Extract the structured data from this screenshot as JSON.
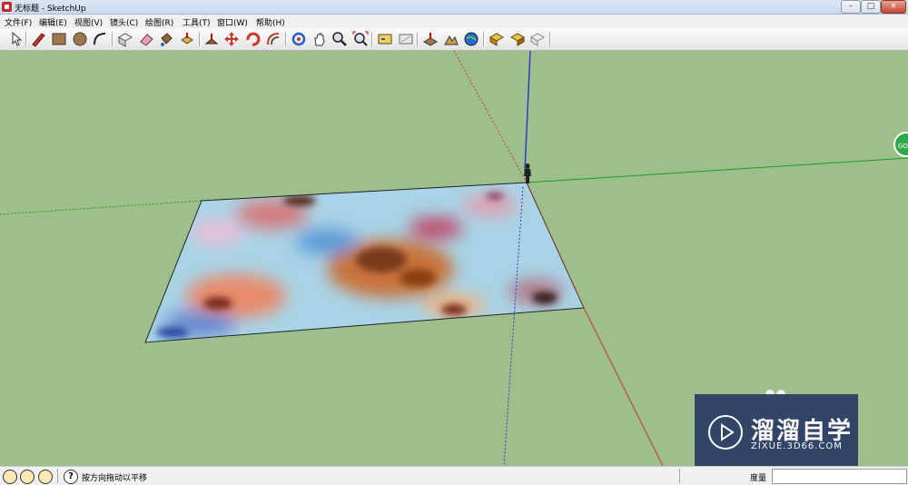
{
  "window": {
    "title": "无标题 - SketchUp"
  },
  "menu": [
    "文件(F)",
    "编辑(E)",
    "视图(V)",
    "镜头(C)",
    "绘图(R)",
    "工具(T)",
    "窗口(W)",
    "帮助(H)"
  ],
  "window_controls": {
    "minimize": "–",
    "maximize": "□",
    "close": "×"
  },
  "toolbar": {
    "tools": [
      "select-tool",
      "line-tool",
      "rectangle-tool",
      "circle-tool",
      "arc-tool",
      "make-component-tool",
      "eraser-tool",
      "paint-bucket-tool",
      "push-pull-tool",
      "follow-me-tool",
      "move-tool",
      "rotate-tool",
      "offset-tool",
      "orbit-tool",
      "pan-tool",
      "zoom-tool",
      "zoom-extents-tool",
      "get-models-tool",
      "share-model-tool",
      "add-location-tool",
      "toggle-terrain-tool",
      "google-earth-tool",
      "get-photo-texture-tool",
      "share-component-tool",
      "preview-tool"
    ]
  },
  "scene": {
    "background_color": "#9ebf8b",
    "axis_colors": {
      "red": "#c23a2a",
      "green": "#1f9e1f",
      "blue": "#2a3fc6"
    },
    "badge_label": "GO"
  },
  "status": {
    "hint": "按方向拖动以平移",
    "measure_label": "度量",
    "measure_value": ""
  },
  "watermark": {
    "title": "溜溜自学",
    "subtitle": "ZIXUE.3D66.COM"
  }
}
